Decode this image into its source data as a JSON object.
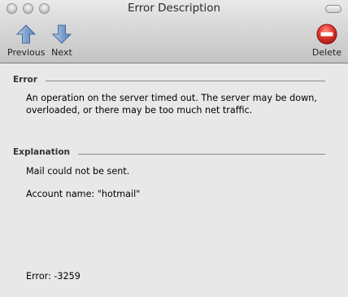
{
  "window": {
    "title": "Error Description"
  },
  "toolbar": {
    "previous_label": "Previous",
    "next_label": "Next",
    "delete_label": "Delete"
  },
  "icons": {
    "previous": "up-arrow-icon",
    "next": "down-arrow-icon",
    "delete": "delete-icon"
  },
  "colors": {
    "arrow_blue": "#7fa3cf",
    "delete_red": "#d7271f"
  },
  "error_section": {
    "heading": "Error",
    "line1": "An operation on the server timed out. The server may be down,",
    "line2": "overloaded, or there may be too much net traffic."
  },
  "explanation_section": {
    "heading": "Explanation",
    "line1": "Mail could not be sent.",
    "line2": "Account name: \"hotmail\""
  },
  "error_code": "Error: -3259"
}
